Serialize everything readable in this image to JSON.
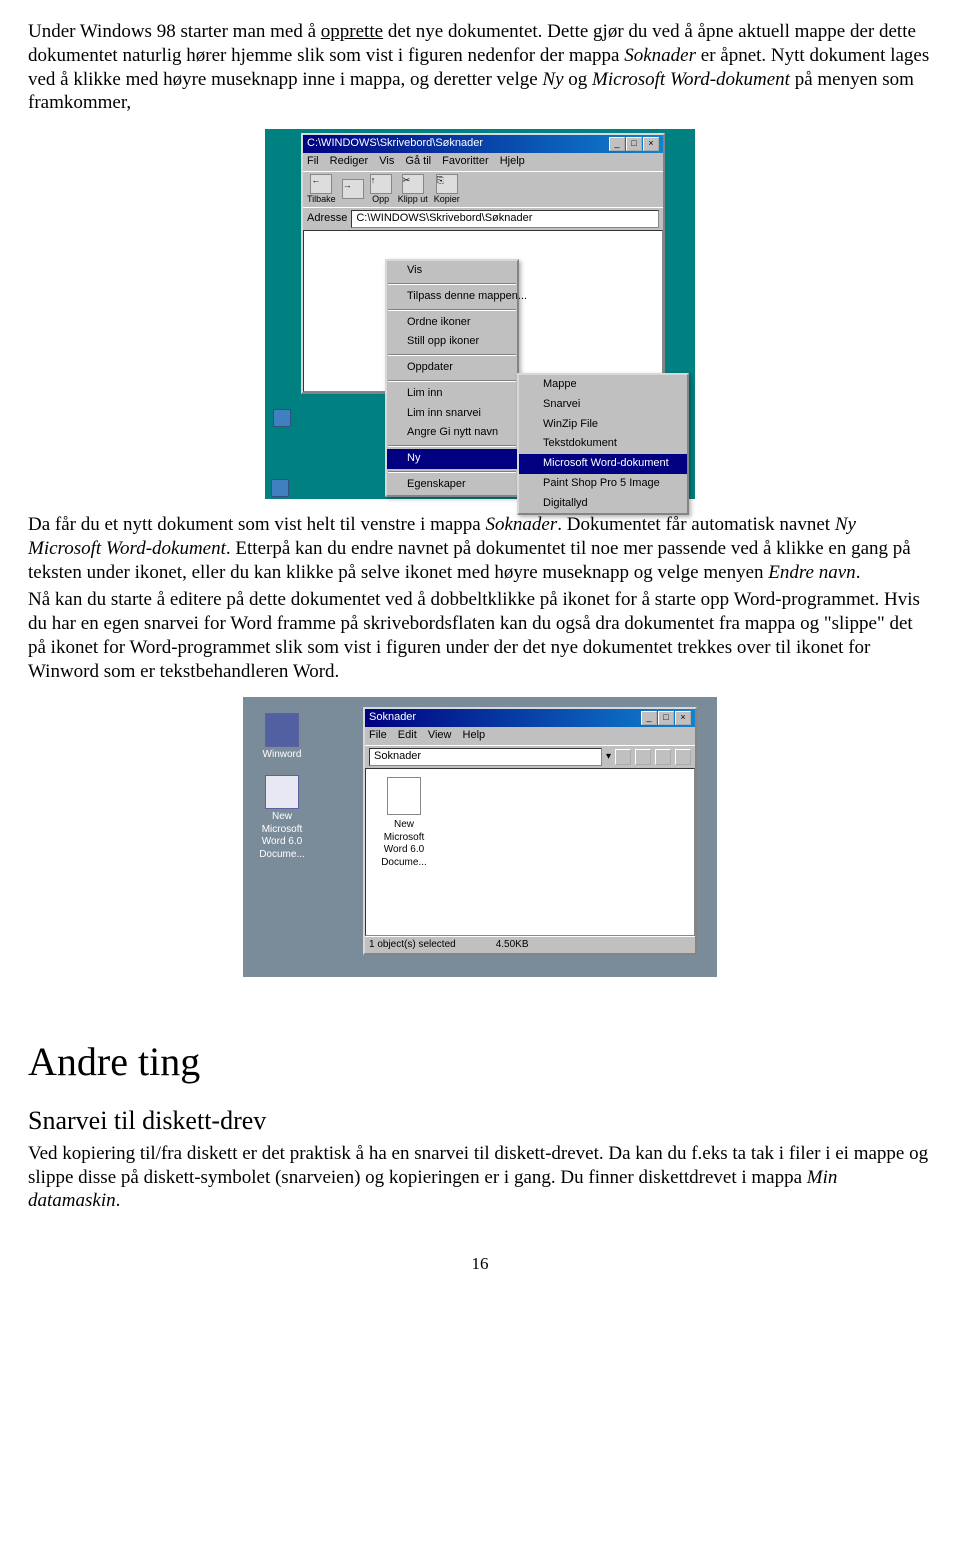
{
  "para1_a": "Under Windows 98 starter man med å ",
  "para1_u": "opprette",
  "para1_b": " det nye dokumentet. Dette gjør du ved å åpne aktuell mappe der dette dokumentet naturlig hører hjemme slik som vist i figuren nedenfor der mappa ",
  "para1_i1": "Soknader",
  "para1_c": " er åpnet. Nytt dokument lages ved å klikke med høyre museknapp inne i mappa, og deretter velge ",
  "para1_i2": "Ny",
  "para1_d": " og ",
  "para1_i3": "Microsoft Word-dokument",
  "para1_e": " på menyen som framkommer,",
  "fig1": {
    "title": "C:\\WINDOWS\\Skrivebord\\Søknader",
    "menu": [
      "Fil",
      "Rediger",
      "Vis",
      "Gå til",
      "Favoritter",
      "Hjelp"
    ],
    "tool_labels": [
      "Tilbake",
      "",
      "Opp",
      "Klipp ut",
      "Kopier"
    ],
    "addr_label": "Adresse",
    "addr_value": "C:\\WINDOWS\\Skrivebord\\Søknader",
    "ctx": [
      "Vis",
      "Tilpass denne mappen...",
      "Ordne ikoner",
      "Still opp ikoner",
      "Oppdater",
      "Lim inn",
      "Lim inn snarvei",
      "Angre Gi nytt navn",
      "Ny",
      "Egenskaper"
    ],
    "sub": [
      "Mappe",
      "Snarvei",
      "WinZip File",
      "Tekstdokument",
      "Microsoft Word-dokument",
      "Paint Shop Pro 5 Image",
      "Digitallyd"
    ]
  },
  "para2_a": "Da får du et nytt dokument som vist helt til venstre i mappa ",
  "para2_i1": "Soknader",
  "para2_b": ". Dokumentet får automatisk navnet ",
  "para2_i2": "Ny Microsoft Word-dokument",
  "para2_c": ". Etterpå kan du endre navnet på dokumentet til noe mer passende ved å klikke en gang på teksten under ikonet, eller du kan klikke på selve ikonet med høyre museknapp og velge menyen ",
  "para2_i3": "Endre navn",
  "para2_d": ".",
  "para3": "Nå kan du starte å editere på dette dokumentet ved å dobbeltklikke på ikonet for å starte opp Word-programmet. Hvis du har en egen snarvei for Word framme på skrivebordsflaten kan du også dra dokumentet fra mappa og \"slippe\" det på ikonet for Word-programmet slik som vist i figuren under der det nye dokumentet trekkes over til ikonet for Winword som er tekstbehandleren Word.",
  "fig2": {
    "winword": "Winword",
    "docname": "New Microsoft Word 6.0 Docume...",
    "title": "Soknader",
    "menu": [
      "File",
      "Edit",
      "View",
      "Help"
    ],
    "folder_label": "Soknader",
    "file_label": "New Microsoft Word 6.0 Docume...",
    "status_left": "1 object(s) selected",
    "status_right": "4.50KB"
  },
  "h1": "Andre ting",
  "h2": "Snarvei til diskett-drev",
  "para4_a": "Ved kopiering til/fra diskett er det praktisk å ha en snarvei til diskett-drevet. Da kan du f.eks ta tak i filer i ei mappe og slippe disse på diskett-symbolet (snarveien) og kopieringen er i gang. Du finner diskettdrevet i mappa ",
  "para4_i": "Min datamaskin",
  "para4_b": ".",
  "page": "16"
}
